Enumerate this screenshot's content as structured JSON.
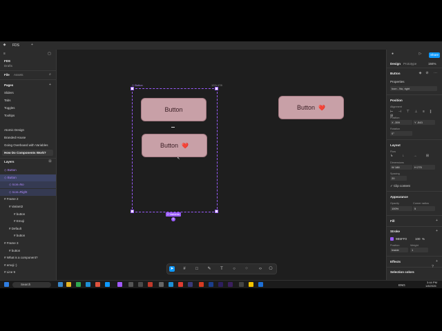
{
  "tabbar": {
    "tab_title": "FDS"
  },
  "left": {
    "file_name": "FDS",
    "file_sub": "Drafts",
    "file_tab": "File",
    "assets_tab": "Assets",
    "pages_header": "Pages",
    "pages": [
      "Sliders",
      "Tabs",
      "Toggles",
      "Tooltips"
    ],
    "sections": [
      "Atomic Design",
      "Branded House",
      "Going Overboard with Variables",
      "How Do Components Work?"
    ],
    "layers_header": "Layers",
    "layers": [
      {
        "label": "Button",
        "indent": 0,
        "style": "purple"
      },
      {
        "label": "Button",
        "indent": 0,
        "style": "selected"
      },
      {
        "label": "Icon=No",
        "indent": 1,
        "style": "sub"
      },
      {
        "label": "Icon=Right",
        "indent": 1,
        "style": "sub"
      },
      {
        "label": "Frame 2",
        "indent": 0,
        "style": "normal"
      },
      {
        "label": "Variant2",
        "indent": 1,
        "style": "normal"
      },
      {
        "label": "button",
        "indent": 2,
        "style": "normal"
      },
      {
        "label": "Emoji",
        "indent": 2,
        "style": "normal"
      },
      {
        "label": "Default",
        "indent": 1,
        "style": "normal"
      },
      {
        "label": "button",
        "indent": 2,
        "style": "normal"
      },
      {
        "label": "Frame 3",
        "indent": 0,
        "style": "normal"
      },
      {
        "label": "button",
        "indent": 1,
        "style": "normal"
      },
      {
        "label": "What is a component?",
        "indent": 0,
        "style": "normal"
      },
      {
        "label": "emoji :)",
        "indent": 0,
        "style": "normal"
      },
      {
        "label": "Line 9",
        "indent": 0,
        "style": "normal"
      }
    ]
  },
  "canvas": {
    "frame_label": "Button",
    "frame_size": "122×178",
    "variants_badge": "2 Variants",
    "button_default": "Button",
    "button_icon": "Button",
    "button_standalone": "Button",
    "emoji": "❤️",
    "accent": "#9b5cff",
    "button_fill": "#c8a0a7"
  },
  "right": {
    "share_label": "Share",
    "zoom": "184%",
    "design_tab": "Design",
    "prototype_tab": "Prototype",
    "selection_name": "Button",
    "properties_label": "Properties",
    "property_value": "Icon - No, right",
    "position_label": "Position",
    "alignment_label": "Alignment",
    "position_x": "-359",
    "position_y": "-543",
    "rotation_label": "Rotation",
    "rotation": "0°",
    "layout_label": "Layout",
    "flow_label": "Flow",
    "dimensions_label": "Dimensions",
    "width": "188",
    "height": "275",
    "spacing_label": "Spacing",
    "spacing": "20",
    "clip_label": "Clip content",
    "appearance_label": "Appearance",
    "opacity_label": "Opacity",
    "opacity": "100%",
    "corner_label": "Corner radius",
    "corner": "5",
    "fill_label": "Fill",
    "stroke_label": "Stroke",
    "stroke_hex": "9B5FF0",
    "stroke_pct": "100",
    "stroke_unit": "%",
    "stroke_position_label": "Position",
    "stroke_weight_label": "Weight",
    "stroke_position": "Inside",
    "stroke_weight": "1",
    "effects_label": "Effects",
    "selection_colors_label": "Selection colors"
  },
  "taskbar": {
    "search_placeholder": "Search",
    "lang": "ENG",
    "time": "3:44 PM",
    "date": "1/8/2026"
  }
}
